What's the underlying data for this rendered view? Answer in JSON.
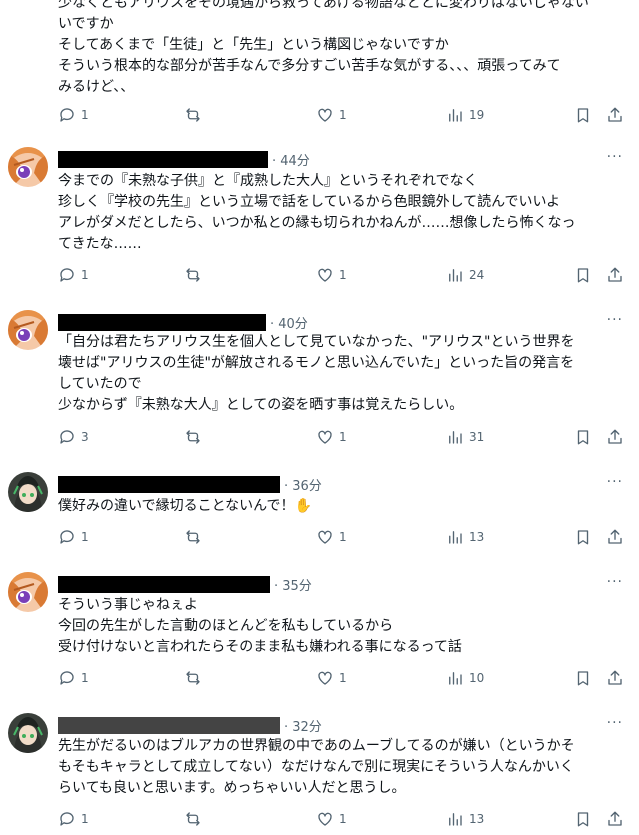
{
  "posts": [
    {
      "lines": [
        "少なくともアリウスをその境遇から救ってあげる物語などとに変わりはないじゃない",
        "いですか",
        "そしてあくまで「生徒」と「先生」という構図じゃないですか",
        "そういう根本的な部分が苦手なんで多分すごい苦手な気がする、、、頑張ってみて",
        "みるけど、、"
      ],
      "replies": "1",
      "reposts": "",
      "likes": "1",
      "views": "19"
    },
    {
      "time": "· 44分",
      "lines": [
        "今までの『未熟な子供』と『成熟した大人』というそれぞれでなく",
        "珍しく『学校の先生』という立場で話をしているから色眼鏡外して読んでいいよ",
        "アレがダメだとしたら、いつか私との縁も切られかねんが……想像したら怖くなっ",
        "てきたな……"
      ],
      "replies": "1",
      "reposts": "",
      "likes": "1",
      "views": "24"
    },
    {
      "time": "· 40分",
      "lines": [
        "「自分は君たちアリウス生を個人として見ていなかった、\"アリウス\"という世界を",
        "壊せば\"アリウスの生徒\"が解放されるモノと思い込んでいた」といった旨の発言を",
        "していたので",
        "少なからず『未熟な大人』としての姿を晒す事は覚えたらしい。"
      ],
      "replies": "3",
      "reposts": "",
      "likes": "1",
      "views": "31"
    },
    {
      "time": "· 36分",
      "lines": [
        "僕好みの違いで縁切ることないんで！✋"
      ],
      "replies": "1",
      "reposts": "",
      "likes": "1",
      "views": "13"
    },
    {
      "time": "· 35分",
      "lines": [
        "そういう事じゃねぇよ",
        "今回の先生がした言動のほとんどを私もしているから",
        "受け付けないと言われたらそのまま私も嫌われる事になるって話"
      ],
      "replies": "1",
      "reposts": "",
      "likes": "1",
      "views": "10"
    },
    {
      "time": "· 32分",
      "lines": [
        "先生がだるいのはブルアカの世界観の中であのムーブしてるのが嫌い（というかそ",
        "もそもキャラとして成立してない）なだけなんで別に現実にそういう人なんかいく",
        "らいても良いと思います。めっちゃいい人だと思うし。"
      ],
      "replies": "1",
      "reposts": "",
      "likes": "1",
      "views": "13"
    }
  ],
  "more_label": "···"
}
